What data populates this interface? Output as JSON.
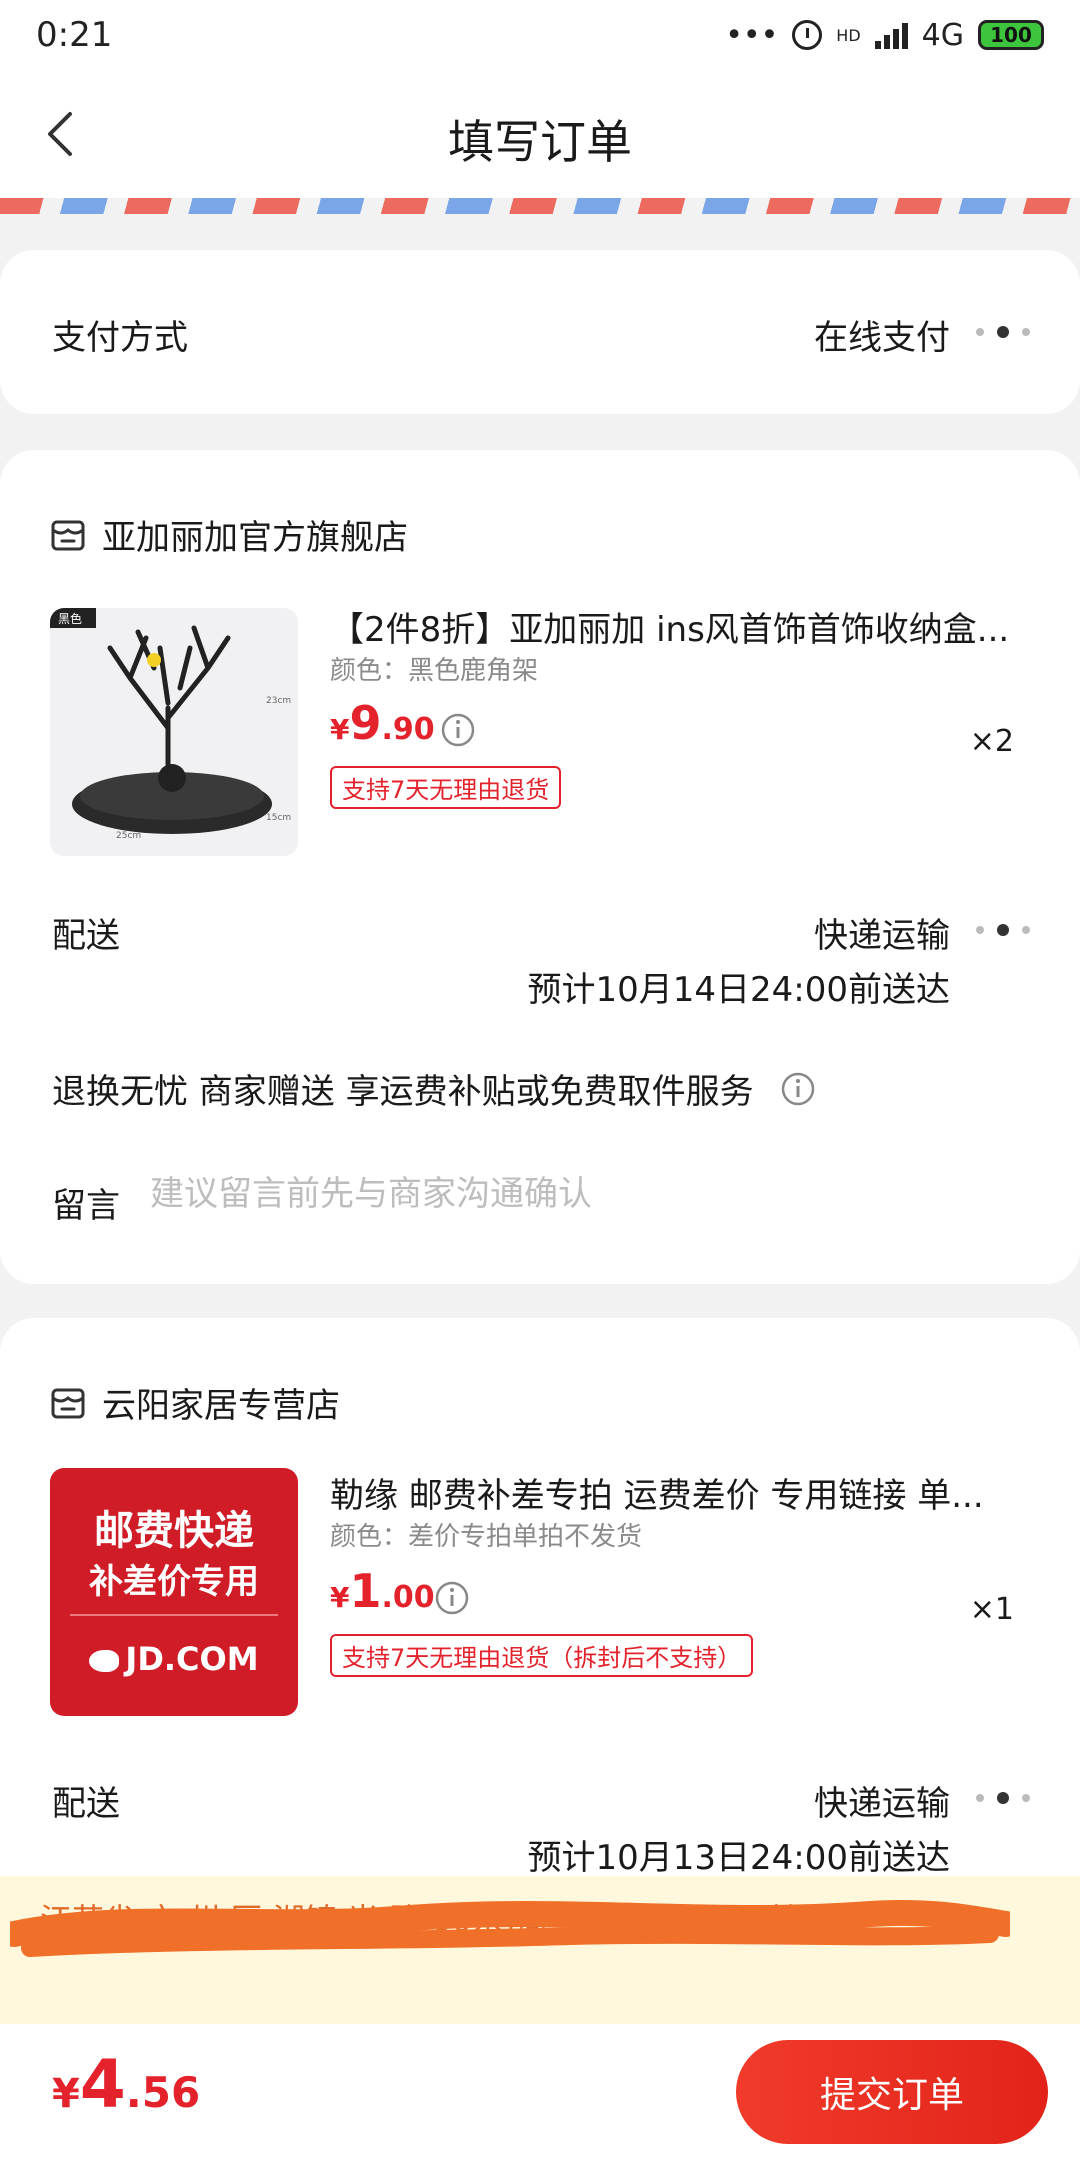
{
  "status_bar": {
    "time": "0:21",
    "network": "4G",
    "hd_label": "HD",
    "battery": "100"
  },
  "header": {
    "title": "填写订单"
  },
  "payment": {
    "label": "支付方式",
    "value": "在线支付"
  },
  "stores": [
    {
      "name": "亚加丽加官方旗舰店",
      "product": {
        "title": "【2件8折】亚加丽加 ins风首饰首饰收纳盒...",
        "spec": "颜色：黑色鹿角架",
        "price_currency": "¥",
        "price_int": "9",
        "price_dec": ".90",
        "badge": "支持7天无理由退货",
        "quantity": "×2",
        "image_tag": "黑色",
        "image_dims": [
          "23cm",
          "25cm",
          "15cm"
        ]
      },
      "delivery": {
        "label": "配送",
        "method": "快递运输",
        "eta": "预计10月14日24:00前送达"
      },
      "service": "退换无忧 商家赠送  享运费补贴或免费取件服务",
      "note": {
        "label": "留言",
        "placeholder": "建议留言前先与商家沟通确认"
      }
    },
    {
      "name": "云阳家居专营店",
      "product": {
        "title": "勒缘 邮费补差专拍 运费差价 专用链接 单...",
        "spec": "颜色：差价专拍单拍不发货",
        "price_currency": "¥",
        "price_int": "1",
        "price_dec": ".00",
        "badge": "支持7天无理由退货（拆封后不支持）",
        "quantity": "×1",
        "image_line1": "邮费快递",
        "image_line2": "补差价专用",
        "image_brand": "JD.COM"
      },
      "delivery": {
        "label": "配送",
        "method": "快递运输",
        "eta": "预计10月13日24:00前送达"
      }
    }
  ],
  "address_banner": {
    "text": "江苏省 市 州 区 湖镇 光 路 00米)尚书苑二区224号楼"
  },
  "footer": {
    "total_currency": "¥",
    "total_int": "4",
    "total_dec": ".56",
    "submit_label": "提交订单"
  },
  "colors": {
    "accent": "#e4222c",
    "banner_bg": "#fff8dc",
    "banner_text": "#e06a2a",
    "redaction": "#f0702a"
  }
}
